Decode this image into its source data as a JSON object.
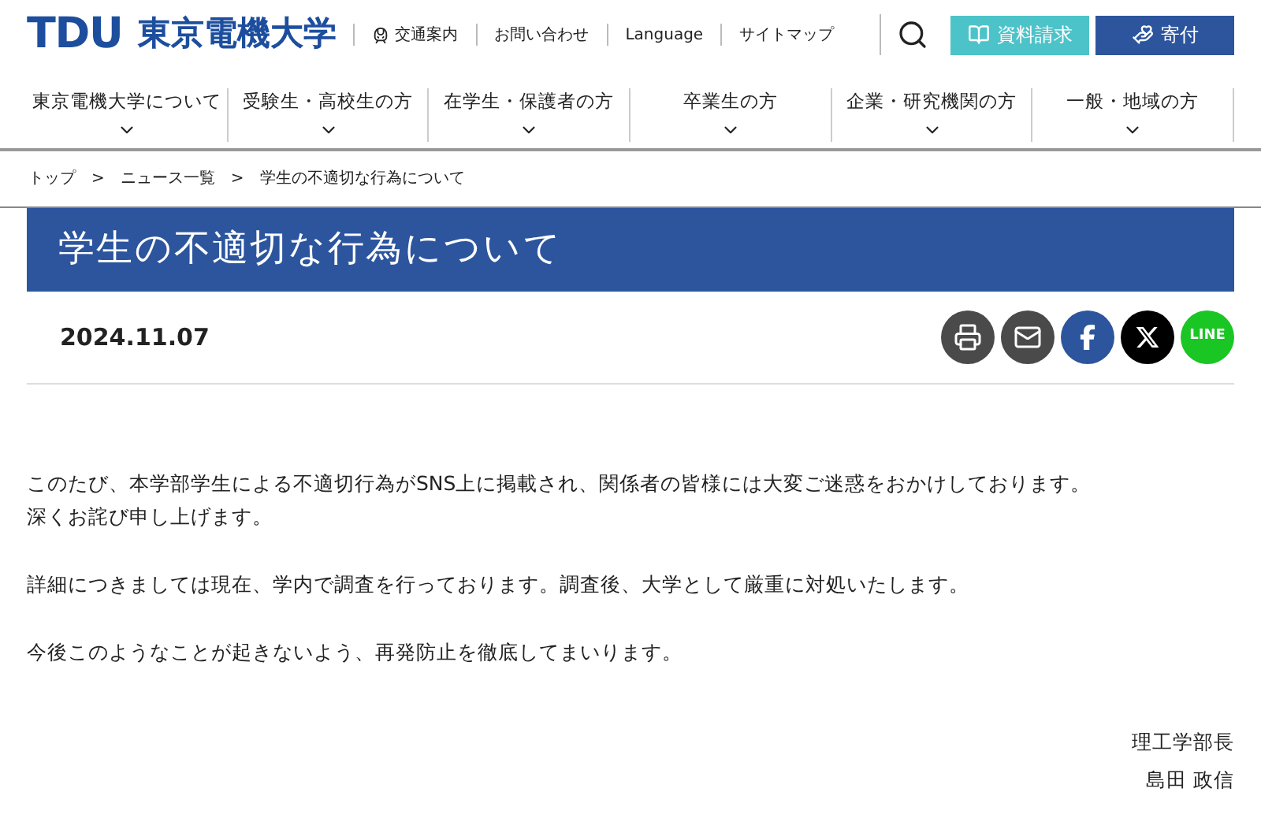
{
  "header": {
    "logo_mark": "TDU",
    "logo_name": "東京電機大学",
    "utility_links": [
      {
        "label": "交通案内",
        "kind": "train"
      },
      {
        "label": "お問い合わせ",
        "kind": "plain"
      },
      {
        "label": "Language",
        "kind": "plain"
      },
      {
        "label": "サイトマップ",
        "kind": "plain"
      }
    ],
    "buttons": [
      {
        "label": "資料請求",
        "kind": "brochure"
      },
      {
        "label": "寄付",
        "kind": "donate"
      }
    ]
  },
  "nav": [
    "東京電機大学について",
    "受験生・高校生の方",
    "在学生・保護者の方",
    "卒業生の方",
    "企業・研究機関の方",
    "一般・地域の方"
  ],
  "breadcrumb": [
    "トップ",
    "ニュース一覧",
    "学生の不適切な行為について"
  ],
  "breadcrumb_separator": ">",
  "title": "学生の不適切な行為について",
  "date": "2024.11.07",
  "share": [
    {
      "kind": "print"
    },
    {
      "kind": "mail"
    },
    {
      "kind": "facebook"
    },
    {
      "kind": "x"
    },
    {
      "kind": "line",
      "label": "LINE"
    }
  ],
  "body": [
    [
      "このたび、本学部学生による不適切行為がSNS上に掲載され、関係者の皆様には大変ご迷惑をおかけしております。",
      "深くお詫び申し上げます。"
    ],
    [
      "詳細につきましては現在、学内で調査を行っております。調査後、大学として厳重に対処いたします。"
    ],
    [
      "今後このようなことが起きないよう、再発防止を徹底してまいります。"
    ]
  ],
  "signature": [
    "理工学部長",
    "島田 政信"
  ]
}
